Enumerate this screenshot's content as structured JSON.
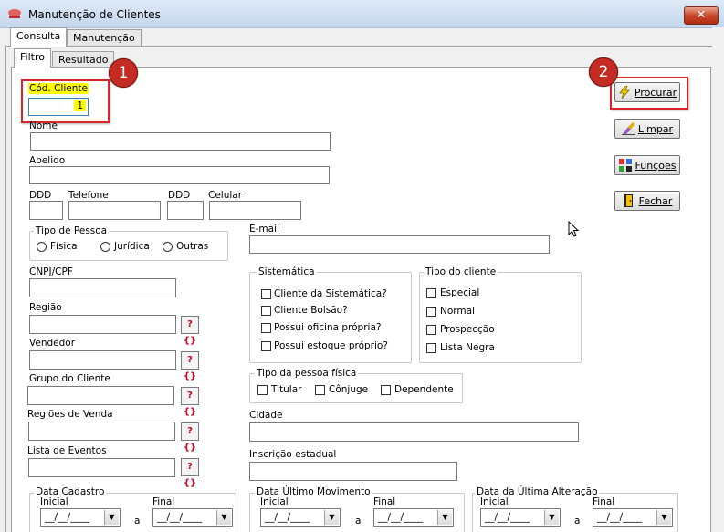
{
  "window": {
    "title": "Manutenção de Clientes",
    "close_glyph": "✕"
  },
  "tabs_main": [
    "Consulta",
    "Manutenção"
  ],
  "tabs_sub": [
    "Filtro",
    "Resultado"
  ],
  "badges": [
    "1",
    "2"
  ],
  "fields": {
    "cod_cliente": {
      "label": "Cód. Cliente",
      "value": "1"
    },
    "nome": "Nome",
    "apelido": "Apelido",
    "ddd1": "DDD",
    "telefone": "Telefone",
    "ddd2": "DDD",
    "celular": "Celular",
    "email": "E-mail",
    "cnpj": "CNPJ/CPF",
    "regiao": "Região",
    "vendedor": "Vendedor",
    "grupo": "Grupo do Cliente",
    "regioes_venda": "Regiões de Venda",
    "lista_eventos": "Lista de Eventos",
    "cidade": "Cidade",
    "inscricao": "Inscrição estadual"
  },
  "lookup_glyph": "?{}",
  "tipo_pessoa": {
    "title": "Tipo de Pessoa",
    "options": [
      "Física",
      "Jurídica",
      "Outras"
    ]
  },
  "sistematica": {
    "title": "Sistemática",
    "options": [
      "Cliente da Sistemática?",
      "Cliente Bolsão?",
      "Possui oficina própria?",
      "Possui estoque próprio?"
    ]
  },
  "tipo_cliente": {
    "title": "Tipo do cliente",
    "options": [
      "Especial",
      "Normal",
      "Prospecção",
      "Lista Negra"
    ]
  },
  "tipo_pessoa_fisica": {
    "title": "Tipo da pessoa física",
    "options": [
      "Titular",
      "Cônjuge",
      "Dependente"
    ]
  },
  "buttons": {
    "procurar": "Procurar",
    "limpar": "Limpar",
    "funcoes": "Funções",
    "fechar": "Fechar"
  },
  "date_groups": [
    {
      "title": "Data Cadastro",
      "inicial": "Inicial",
      "final": "Final",
      "sep": "a",
      "value_start": "__/__/____",
      "value_end": "__/__/____"
    },
    {
      "title": "Data Último Movimento",
      "inicial": "Inicial",
      "final": "Final",
      "sep": "a",
      "value_start": "__/__/____",
      "value_end": "__/__/____"
    },
    {
      "title": "Data da Última Alteração",
      "inicial": "Inicial",
      "final": "Final",
      "sep": "a",
      "value_start": "__/__/____",
      "value_end": "__/__/____"
    }
  ],
  "colors": {
    "accent_red": "#d9242a",
    "highlight_yellow": "#ffff00",
    "badge_red": "#c32b23"
  }
}
